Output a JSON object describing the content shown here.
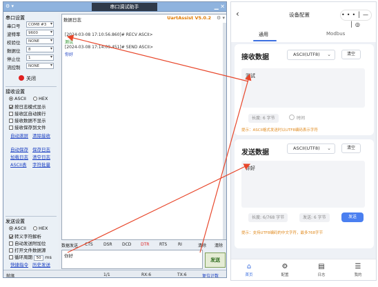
{
  "desktop": {
    "title": "串口调试助手",
    "title_left": "⚙ ▾",
    "title_controls": "▁ ✕",
    "serial_settings": {
      "title": "串口设置",
      "rows": [
        {
          "label": "串口号",
          "value": "COM8 #3"
        },
        {
          "label": "波特率",
          "value": "9600"
        },
        {
          "label": "校验位",
          "value": "NONE"
        },
        {
          "label": "数据位",
          "value": "8"
        },
        {
          "label": "停止位",
          "value": "1"
        },
        {
          "label": "流控制",
          "value": "NONE"
        }
      ],
      "open_button": "关闭"
    },
    "recv_settings": {
      "title": "接收设置",
      "ascii": "ASCII",
      "hex": "HEX",
      "options": [
        "按日志模式显示",
        "接收区自动换行",
        "接收数据不显示",
        "接收保存到文件"
      ],
      "links": [
        "自动滚屏",
        "清除接收"
      ]
    },
    "mid_links": [
      "自动保存",
      "保存日志",
      "加载日志",
      "清空日志",
      "ASCII表",
      "字符批量"
    ],
    "send_settings": {
      "title": "发送设置",
      "ascii": "ASCII",
      "hex": "HEX",
      "options": [
        "转义字符解析",
        "自动发送附加位",
        "打开文件数据源",
        "循环周期"
      ],
      "period_value": "50",
      "period_unit": "ms",
      "links": [
        "快捷指令",
        "历史发送"
      ]
    },
    "recv_pane": {
      "tab": "数据日志",
      "brand": "UartAssist V5.0.2",
      "icons": "⚙ ▾",
      "lines": [
        {
          "text": "[2024-03-08 17:10:56.860]# RECV ASCII>",
          "color": "#333333"
        },
        {
          "text": "测试",
          "color": "#1a8a1a"
        },
        {
          "text": "[2024-03-08 17:14:09.451]# SEND ASCII>",
          "color": "#333333"
        },
        {
          "text": "你好",
          "color": "#1a3fc2"
        }
      ]
    },
    "send_bar": {
      "label": "数据发送",
      "items": [
        "CTS",
        "DSR",
        "DCD",
        "DTR",
        "RTS",
        "RI"
      ],
      "clear": "清除",
      "clear2": "清除"
    },
    "send_text": "你好",
    "send_button": "发送",
    "status": {
      "left": "就绪",
      "rx": "1/1",
      "tx": "RX:6",
      "tx2": "TX:6",
      "reset": "复位计数"
    }
  },
  "phone": {
    "title": "设备配置",
    "back_icon": "‹",
    "capsule": "•••│—│◎",
    "tabs": [
      "通用",
      "Modbus"
    ],
    "receive": {
      "title": "接收数据",
      "encoding": "ASCII(UTF8)",
      "clear": "清空",
      "text": "测试",
      "length_pill": "长度: 6 字节",
      "time_pill": "时间",
      "hint": "提示：ASCII格式发送时以UTF8编码表示字符"
    },
    "send": {
      "title": "发送数据",
      "encoding": "ASCII(UTF8)",
      "clear": "清空",
      "text": "你好",
      "length_pill": "长度: 6/768 字节",
      "sent_pill": "发送: 6 字节",
      "send_button": "发送",
      "hint": "提示：支持UTF8编码的中文字符，最多768字节"
    },
    "nav": [
      {
        "label": "首页",
        "icon": "home-icon"
      },
      {
        "label": "配置",
        "icon": "settings-icon"
      },
      {
        "label": "日志",
        "icon": "log-icon"
      },
      {
        "label": "我的",
        "icon": "profile-icon"
      }
    ]
  },
  "colors": {
    "accent": "#3b6fe0",
    "arrow": "#e8462a",
    "brand": "#e07a00",
    "hint": "#e08a1e"
  }
}
